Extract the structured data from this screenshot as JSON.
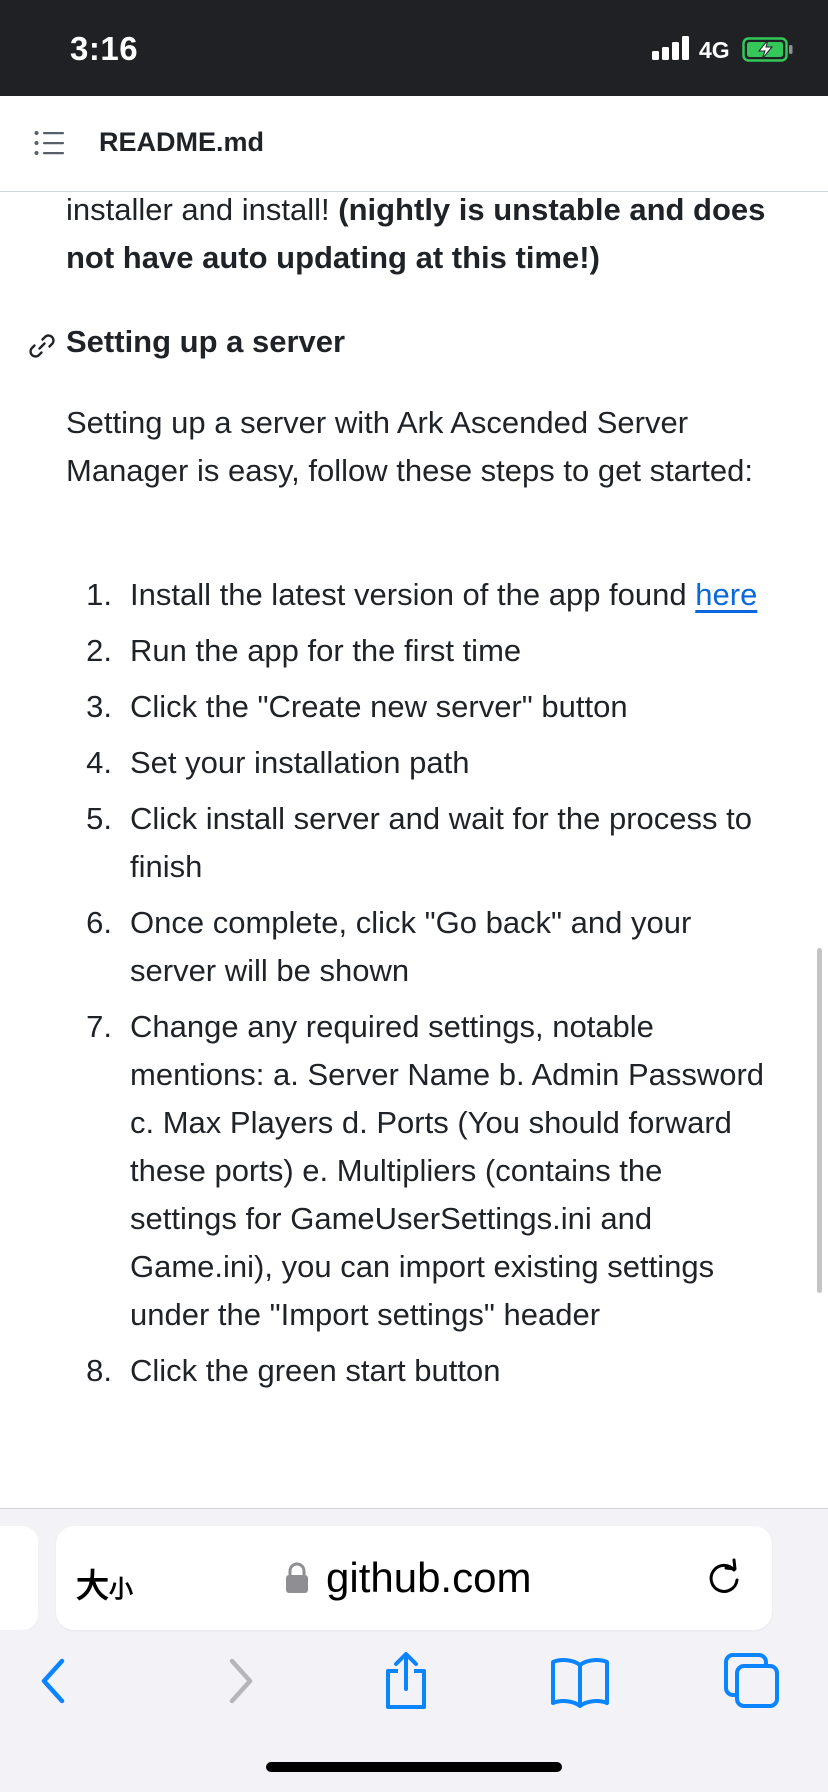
{
  "status_bar": {
    "time": "3:16",
    "network": "4G"
  },
  "header": {
    "title": "README.md",
    "toc_icon": "list-icon"
  },
  "content": {
    "intro_tail_plain": "installer and install! ",
    "intro_tail_bold": "(nightly is unstable and does not have auto updating at this time!)",
    "section_heading": "Setting up a server",
    "section_paragraph": "Setting up a server with Ark Ascended Server Manager is easy, follow these steps to get started:",
    "steps": [
      {
        "num": "1.",
        "text": "Install the latest version of the app found ",
        "link": "here"
      },
      {
        "num": "2.",
        "text": "Run the app for the first time"
      },
      {
        "num": "3.",
        "text": "Click the \"Create new server\" button"
      },
      {
        "num": "4.",
        "text": "Set your installation path"
      },
      {
        "num": "5.",
        "text": "Click install server and wait for the process to finish"
      },
      {
        "num": "6.",
        "text": "Once complete, click \"Go back\" and your server will be shown"
      },
      {
        "num": "7.",
        "text": "Change any required settings, notable mentions: a. Server Name b. Admin Password c. Max Players d. Ports (You should forward these ports) e. Multipliers (contains the settings for GameUserSettings.ini and Game.ini), you can import existing settings under the \"Import settings\" header"
      },
      {
        "num": "8.",
        "text": "Click the green start button"
      }
    ]
  },
  "safari": {
    "text_size_label_big": "大",
    "text_size_label_small": "小",
    "url": "github.com"
  },
  "colors": {
    "link": "#0969da",
    "system_blue": "#0a84ff",
    "status_bar_bg": "#1f2125",
    "battery_green": "#34c759"
  }
}
